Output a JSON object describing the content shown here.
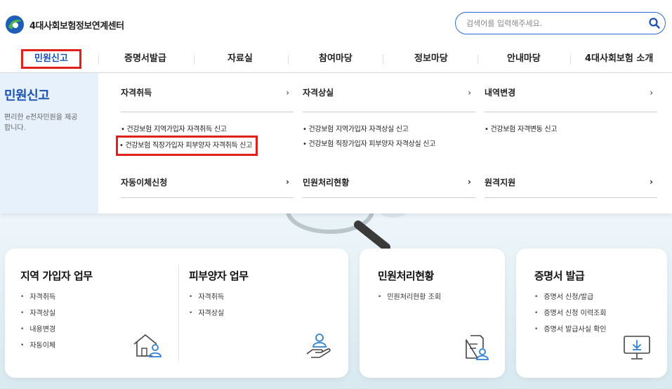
{
  "header": {
    "logo_text": "4대사회보험정보연계센터",
    "search_placeholder": "검색어를 입력해주세요."
  },
  "gnb": {
    "items": [
      {
        "label": "민원신고"
      },
      {
        "label": "증명서발급"
      },
      {
        "label": "자료실"
      },
      {
        "label": "참여마당"
      },
      {
        "label": "정보마당"
      },
      {
        "label": "안내마당"
      },
      {
        "label": "4대사회보험 소개"
      }
    ]
  },
  "mega": {
    "side_title": "민원신고",
    "side_desc": "편리한 e전자민원을 제공합니다.",
    "arrow": "›",
    "columns": [
      {
        "head": "자격취득",
        "links": [
          "• 건강보험 지역가입자 자격취득 신고",
          "• 건강보험 직장가입자 피부양자 자격취득 신고"
        ],
        "head2": "자동이체신청"
      },
      {
        "head": "자격상실",
        "links": [
          "• 건강보험 지역가입자 자격상실 신고",
          "• 건강보험 직장가입자 피부양자 자격상실 신고"
        ],
        "head2": "민원처리현황"
      },
      {
        "head": "내역변경",
        "links": [
          "• 건강보험 자격변동 신고"
        ],
        "head2": "원격지원"
      }
    ]
  },
  "cards": {
    "regional": {
      "title": "지역 가입자 업무",
      "items": [
        "자격취득",
        "자격상실",
        "내용변경",
        "자동이체"
      ]
    },
    "dependent": {
      "title": "피부양자 업무",
      "items": [
        "자격취득",
        "자격상실"
      ]
    },
    "status": {
      "title": "민원처리현황",
      "items": [
        "민원처리현황 조회"
      ]
    },
    "certificate": {
      "title": "증명서 발급",
      "items": [
        "증명서 신청/발급",
        "증명서 신청 이력조회",
        "증명서 발급사실 확인"
      ]
    }
  },
  "colors": {
    "accent": "#1a4fb4",
    "highlight": "#e0201b",
    "side_bg": "#e6f1fb"
  }
}
